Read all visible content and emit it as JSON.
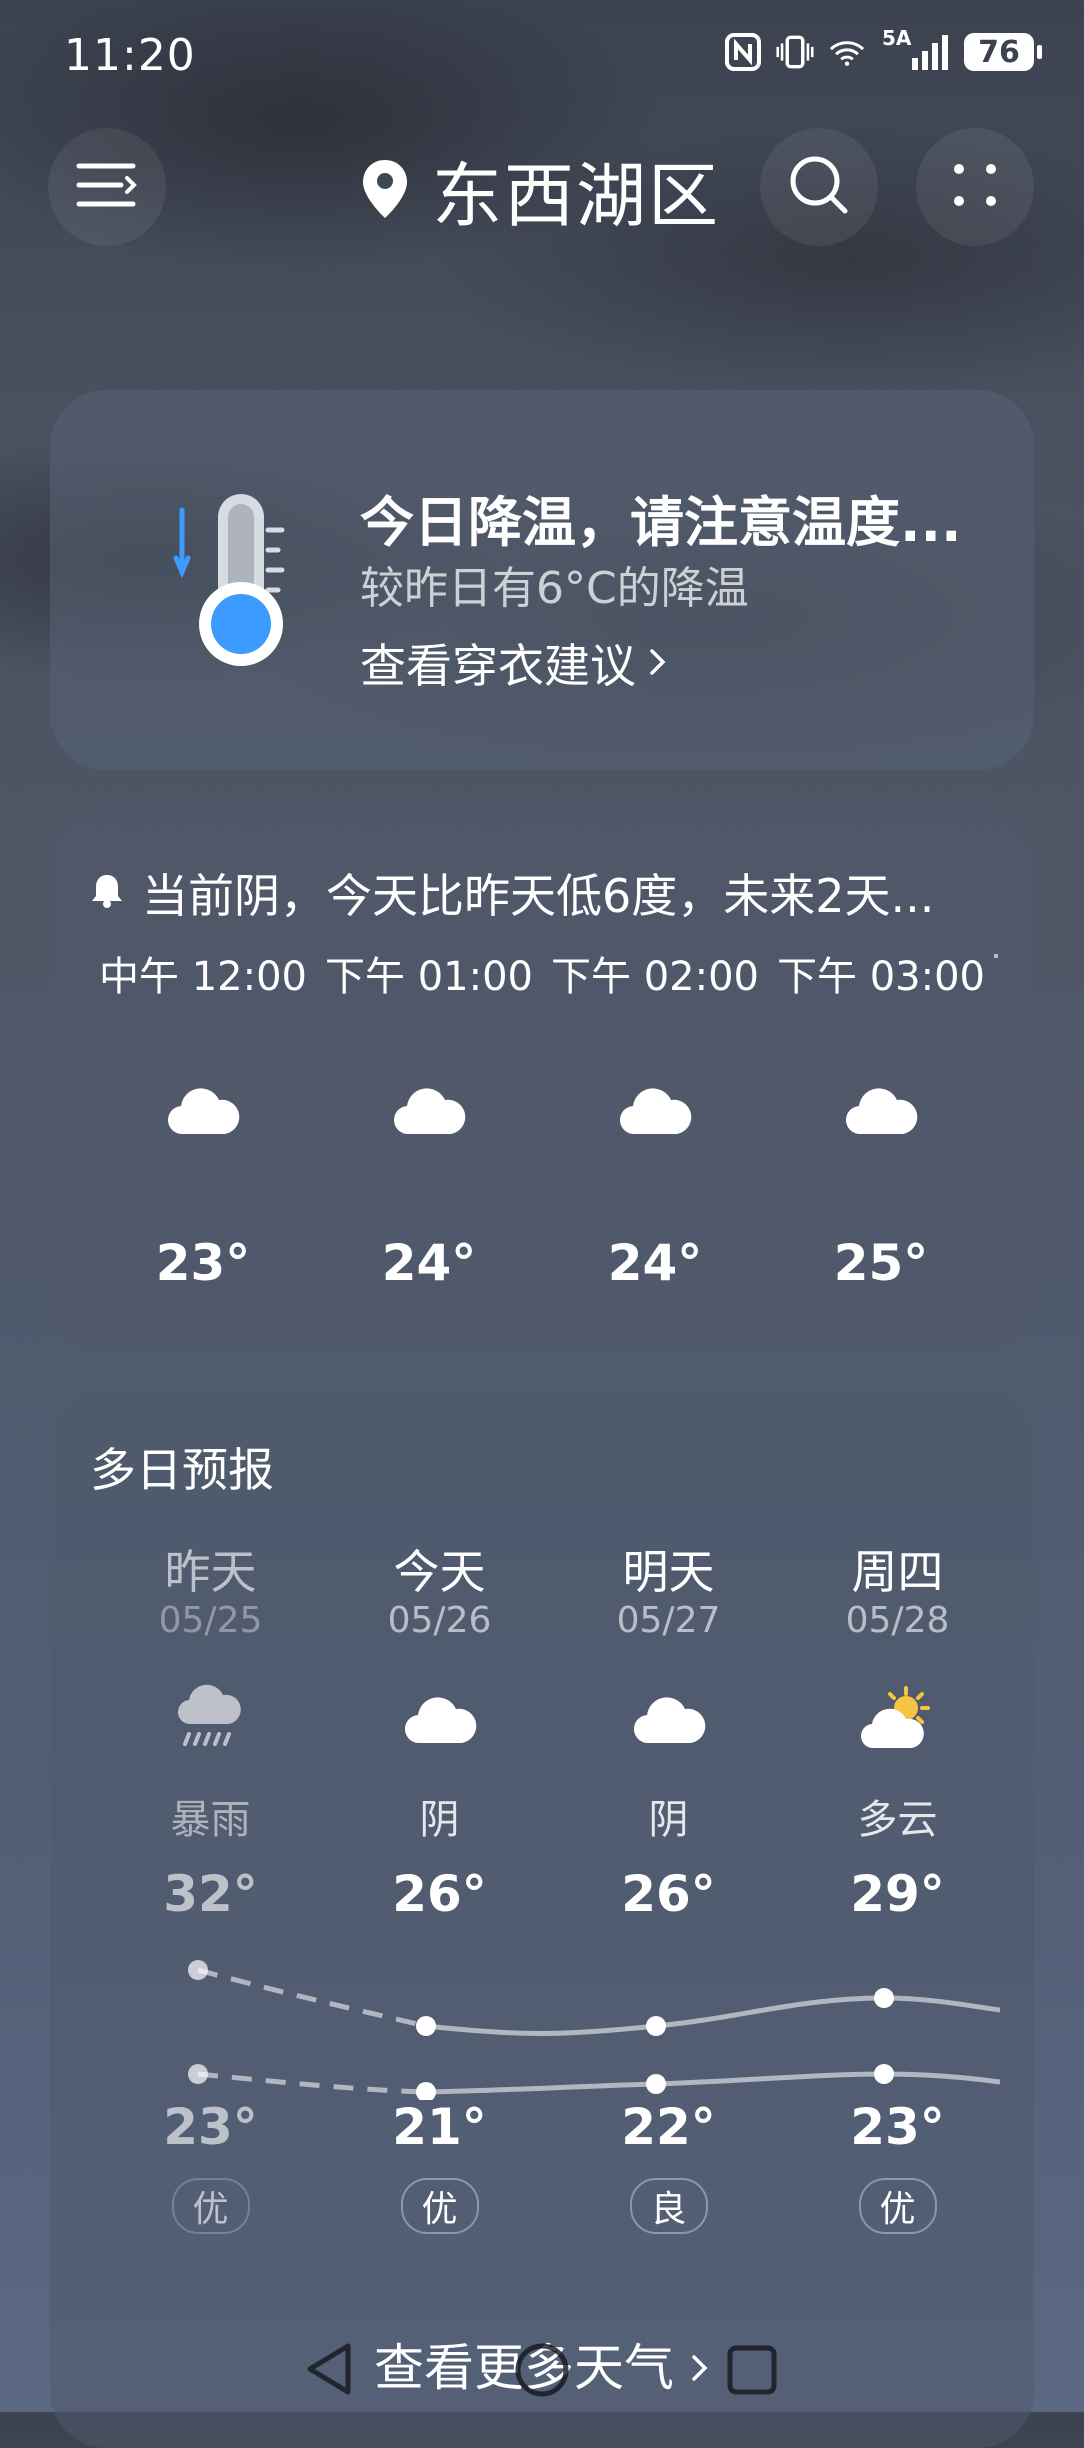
{
  "status_bar": {
    "time": "11:20",
    "network_label": "5A",
    "battery": "76",
    "icons": [
      "nfc-icon",
      "vibrate-icon",
      "wifi-icon",
      "signal-icon",
      "battery-icon"
    ]
  },
  "header": {
    "location": "东西湖区",
    "icons": [
      "menu-icon",
      "location-pin-icon",
      "search-icon",
      "more-icon"
    ]
  },
  "alert": {
    "title": "今日降温，请注意温度...",
    "subtitle": "较昨日有6°C的降温",
    "link": "查看穿衣建议",
    "icon": "thermometer-icon"
  },
  "hourly": {
    "summary": "当前阴，今天比昨天低6度，未来2天...",
    "items": [
      {
        "time": "中午 12:00",
        "icon": "cloudy-icon",
        "temp": "23°"
      },
      {
        "time": "下午 01:00",
        "icon": "cloudy-icon",
        "temp": "24°"
      },
      {
        "time": "下午 02:00",
        "icon": "cloudy-icon",
        "temp": "24°"
      },
      {
        "time": "下午 03:00",
        "icon": "cloudy-icon",
        "temp": "25°"
      }
    ]
  },
  "daily": {
    "title": "多日预报",
    "days": [
      {
        "name": "昨天",
        "date": "05/25",
        "icon": "heavy-rain-icon",
        "condition": "暴雨",
        "high": "32°",
        "low": "23°",
        "aqi": "优"
      },
      {
        "name": "今天",
        "date": "05/26",
        "icon": "cloudy-icon",
        "condition": "阴",
        "high": "26°",
        "low": "21°",
        "aqi": "优"
      },
      {
        "name": "明天",
        "date": "05/27",
        "icon": "cloudy-icon",
        "condition": "阴",
        "high": "26°",
        "low": "22°",
        "aqi": "良"
      },
      {
        "name": "周四",
        "date": "05/28",
        "icon": "partly-cloudy-icon",
        "condition": "多云",
        "high": "29°",
        "low": "23°",
        "aqi": "优"
      }
    ],
    "more_link": "查看更多天气"
  },
  "colors": {
    "background": "#4f5767",
    "card": "#505a6c",
    "thermometer_blue": "#3d9bff",
    "sun": "#f5c542"
  }
}
